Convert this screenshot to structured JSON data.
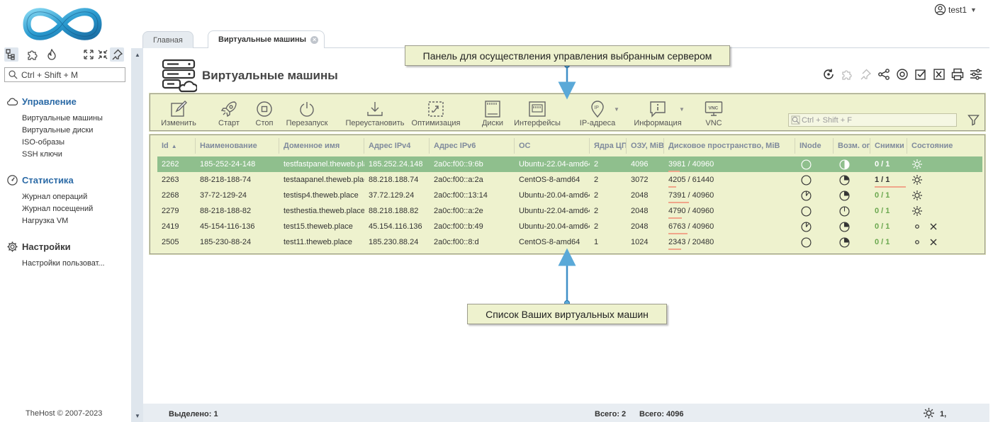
{
  "user": {
    "name": "test1"
  },
  "sidebar": {
    "search_placeholder": "Ctrl + Shift + M",
    "sections": [
      {
        "title": "Управление",
        "items": [
          "Виртуальные машины",
          "Виртуальные диски",
          "ISO-образы",
          "SSH ключи"
        ]
      },
      {
        "title": "Статистика",
        "items": [
          "Журнал операций",
          "Журнал посещений",
          "Нагрузка VM"
        ]
      },
      {
        "title": "Настройки",
        "items": [
          "Настройки пользоват..."
        ]
      }
    ],
    "copyright": "TheHost © 2007-2023"
  },
  "tabs": [
    {
      "label": "Главная",
      "active": false
    },
    {
      "label": "Виртуальные машины",
      "active": true
    }
  ],
  "page": {
    "title": "Виртуальные машины"
  },
  "toolbar": {
    "buttons": [
      "Изменить",
      "Старт",
      "Стоп",
      "Перезапуск",
      "Переустановить",
      "Оптимизация",
      "Диски",
      "Интерфейсы",
      "IP-адреса",
      "Информация",
      "VNC"
    ],
    "search_placeholder": "Ctrl + Shift + F"
  },
  "table": {
    "columns": [
      "Id",
      "Наименование",
      "Доменное имя",
      "Адрес IPv4",
      "Адрес IPv6",
      "ОС",
      "Ядра ЦП",
      "ОЗУ, MiB",
      "Дисковое пространство, MiB",
      "INode",
      "Возм. оп",
      "Снимки",
      "Состояние"
    ],
    "rows": [
      {
        "id": "2262",
        "name": "185-252-24-148",
        "domain": "testfastpanel.theweb.place",
        "ipv4": "185.252.24.148",
        "ipv6": "2a0c:f00::9:6b",
        "os": "Ubuntu-22.04-amd64",
        "cpu": "2",
        "ram": "4096",
        "disk": "3981 / 40960",
        "snapshots": "0 / 1",
        "selected": true,
        "disk_fill": 0.1
      },
      {
        "id": "2263",
        "name": "88-218-188-74",
        "domain": "testaapanel.theweb.place",
        "ipv4": "88.218.188.74",
        "ipv6": "2a0c:f00::a:2a",
        "os": "CentOS-8-amd64",
        "cpu": "2",
        "ram": "3072",
        "disk": "4205 / 61440",
        "snapshots": "1 / 1",
        "selected": false,
        "disk_fill": 0.07
      },
      {
        "id": "2268",
        "name": "37-72-129-24",
        "domain": "testisp4.theweb.place",
        "ipv4": "37.72.129.24",
        "ipv6": "2a0c:f00::13:14",
        "os": "Ubuntu-20.04-amd64",
        "cpu": "2",
        "ram": "2048",
        "disk": "7391 / 40960",
        "snapshots": "0 / 1",
        "selected": false,
        "disk_fill": 0.18
      },
      {
        "id": "2279",
        "name": "88-218-188-82",
        "domain": "testhestia.theweb.place",
        "ipv4": "88.218.188.82",
        "ipv6": "2a0c:f00::a:2e",
        "os": "Ubuntu-22.04-amd64",
        "cpu": "2",
        "ram": "2048",
        "disk": "4790 / 40960",
        "snapshots": "0 / 1",
        "selected": false,
        "disk_fill": 0.12
      },
      {
        "id": "2419",
        "name": "45-154-116-136",
        "domain": "test15.theweb.place",
        "ipv4": "45.154.116.136",
        "ipv6": "2a0c:f00::b:49",
        "os": "Ubuntu-20.04-amd64",
        "cpu": "2",
        "ram": "2048",
        "disk": "6763 / 40960",
        "snapshots": "0 / 1",
        "selected": false,
        "disk_fill": 0.17
      },
      {
        "id": "2505",
        "name": "185-230-88-24",
        "domain": "test11.theweb.place",
        "ipv4": "185.230.88.24",
        "ipv6": "2a0c:f00::8:d",
        "os": "CentOS-8-amd64",
        "cpu": "1",
        "ram": "1024",
        "disk": "2343 / 20480",
        "snapshots": "0 / 1",
        "selected": false,
        "disk_fill": 0.11
      }
    ]
  },
  "callouts": {
    "toolbar_note": "Панель для осуществления управления выбранным сервером",
    "list_note": "Список Ваших виртуальных машин"
  },
  "status": {
    "selected": "Выделено: 1",
    "total_cpu": "Всего: 2",
    "total_ram": "Всего: 4096",
    "state_count": "1,"
  },
  "colors": {
    "accent": "#2b6aa6",
    "panel_bg": "#eef2ce",
    "selected_row": "#8fbf8d",
    "snapshot_green": "#6ba84f",
    "disk_bar": "#f0a58a"
  }
}
